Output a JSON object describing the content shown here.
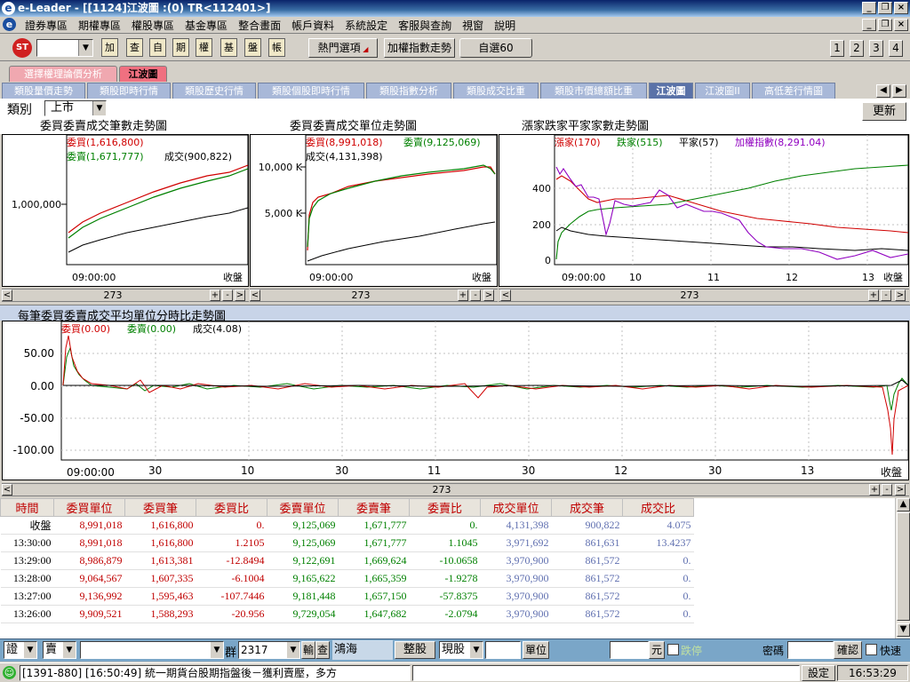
{
  "window": {
    "title": "e-Leader - [[1124]江波圖 :(0) TR<112401>]",
    "icon": "e"
  },
  "menu": [
    "證券專區",
    "期權專區",
    "權股專區",
    "基金專區",
    "整合畫面",
    "帳戶資料",
    "系統設定",
    "客服與查詢",
    "視窗",
    "說明"
  ],
  "toolbar": {
    "icon_buttons": [
      "加",
      "查",
      "自",
      "期",
      "權",
      "基",
      "盤",
      "帳"
    ],
    "hot": "熱門選項",
    "weighted": "加權指數走勢",
    "custom": "自選60",
    "layouts": [
      "1",
      "2",
      "3",
      "4"
    ]
  },
  "tabs_top": [
    "選擇權理論價分析",
    "江波圖"
  ],
  "tabs_second": [
    "類股量價走勢",
    "類股即時行情",
    "類股歷史行情",
    "類股個股即時行情",
    "類股指數分析",
    "類股成交比重",
    "類股市價總額比重",
    "江波圖",
    "江波圖II",
    "高低差行情圖"
  ],
  "filter": {
    "label": "類別",
    "value": "上市",
    "refresh": "更新"
  },
  "chart1": {
    "title": "委買委賣成交筆數走勢圖",
    "legend": [
      {
        "text": "委買(1,616,800)",
        "color": "#d00000"
      },
      {
        "text": "委賣(1,671,777)",
        "color": "#008000"
      },
      {
        "text": "成交(900,822)",
        "color": "#000000"
      }
    ],
    "yticks": [
      "1,000,000"
    ],
    "xstart": "09:00:00",
    "xend": "收盤",
    "scroll": "273"
  },
  "chart2": {
    "title": "委買委賣成交單位走勢圖",
    "legend": [
      {
        "text": "委買(8,991,018)",
        "color": "#d00000"
      },
      {
        "text": "委賣(9,125,069)",
        "color": "#008000"
      },
      {
        "text": "成交(4,131,398)",
        "color": "#000000"
      }
    ],
    "yticks": [
      "10,000 K",
      "5,000 K"
    ],
    "xstart": "09:00:00",
    "xend": "收盤",
    "scroll": "273"
  },
  "chart3": {
    "title": "漲家跌家平家家數走勢圖",
    "legend": [
      {
        "text": "漲家(170)",
        "color": "#d00000"
      },
      {
        "text": "跌家(515)",
        "color": "#008000"
      },
      {
        "text": "平家(57)",
        "color": "#000000"
      },
      {
        "text": "加權指數(8,291.04)",
        "color": "#9000c0"
      }
    ],
    "yticks": [
      "400",
      "200",
      "0"
    ],
    "xticks": [
      "10",
      "11",
      "12",
      "13"
    ],
    "xstart": "09:00:00",
    "xend": "收盤",
    "scroll": "273"
  },
  "chart4": {
    "title": "每筆委買委賣成交平均單位分時比走勢圖",
    "legend": [
      {
        "text": "委買(0.00)",
        "color": "#d00000"
      },
      {
        "text": "委賣(0.00)",
        "color": "#008000"
      },
      {
        "text": "成交(4.08)",
        "color": "#000000"
      }
    ],
    "yticks": [
      "50.00",
      "0.00",
      "-50.00",
      "-100.00"
    ],
    "xticks": [
      "30",
      "10",
      "30",
      "11",
      "30",
      "12",
      "30",
      "13"
    ],
    "xstart": "09:00:00",
    "xend": "收盤",
    "scroll": "273"
  },
  "table": {
    "headers": [
      "時間",
      "委買單位",
      "委買筆",
      "委買比",
      "委賣單位",
      "委賣筆",
      "委賣比",
      "成交單位",
      "成交筆",
      "成交比"
    ],
    "rows": [
      [
        "收盤",
        "8,991,018",
        "1,616,800",
        "0.",
        "9,125,069",
        "1,671,777",
        "0.",
        "4,131,398",
        "900,822",
        "4.075"
      ],
      [
        "13:30:00",
        "8,991,018",
        "1,616,800",
        "1.2105",
        "9,125,069",
        "1,671,777",
        "1.1045",
        "3,971,692",
        "861,631",
        "13.4237"
      ],
      [
        "13:29:00",
        "8,986,879",
        "1,613,381",
        "-12.8494",
        "9,122,691",
        "1,669,624",
        "-10.0658",
        "3,970,900",
        "861,572",
        "0."
      ],
      [
        "13:28:00",
        "9,064,567",
        "1,607,335",
        "-6.1004",
        "9,165,622",
        "1,665,359",
        "-1.9278",
        "3,970,900",
        "861,572",
        "0."
      ],
      [
        "13:27:00",
        "9,136,992",
        "1,595,463",
        "-107.7446",
        "9,181,448",
        "1,657,150",
        "-57.8375",
        "3,970,900",
        "861,572",
        "0."
      ],
      [
        "13:26:00",
        "9,909,521",
        "1,588,293",
        "-20.956",
        "9,729,054",
        "1,647,682",
        "-2.0794",
        "3,970,900",
        "861,572",
        "0."
      ]
    ]
  },
  "order": {
    "type": "證",
    "side": "賣",
    "group": "群",
    "code": "2317",
    "input": "輸",
    "query": "查",
    "name": "鴻海",
    "lot": "整股",
    "cash": "現股",
    "unit": "單位",
    "yuan": "元",
    "stop": "跌停",
    "pwd": "密碼",
    "confirm": "確認",
    "fast": "快速"
  },
  "status": {
    "news": "[1391-880] [16:50:49] 統一期貨台股期指盤後－獲利賣壓，多方",
    "setting": "設定",
    "time": "16:53:29"
  }
}
